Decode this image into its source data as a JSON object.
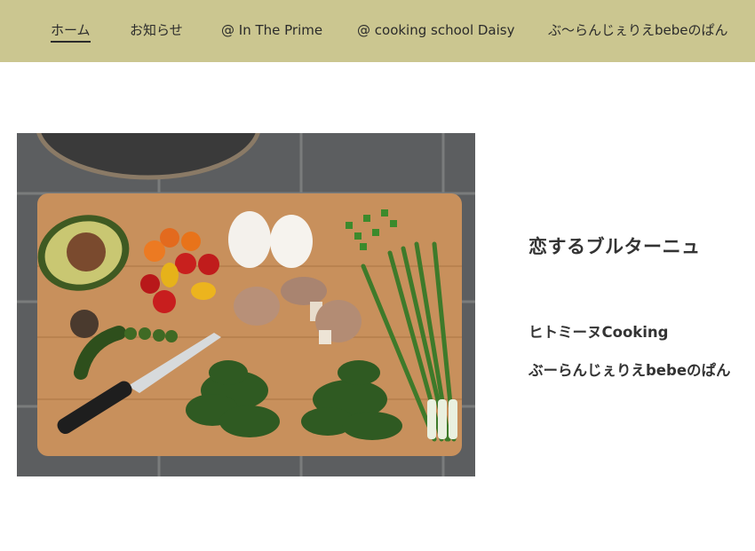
{
  "nav": {
    "items": [
      {
        "label": "ホーム",
        "active": true
      },
      {
        "label": "お知らせ",
        "active": false
      },
      {
        "label": "@ In The Prime",
        "active": false
      },
      {
        "label": "@ cooking school Daisy",
        "active": false
      },
      {
        "label": "ぶ〜らんじぇりえbebeのぱん",
        "active": false
      }
    ]
  },
  "colors": {
    "nav_bg": "#cbc690",
    "text": "#333333"
  },
  "hero_image": {
    "subject": "cutting board with avocado, tomatoes, eggs, mushrooms, spinach, green onions and a knife"
  },
  "side": {
    "title": "恋するブルターニュ",
    "links": [
      {
        "label": "ヒトミーヌCooking"
      },
      {
        "label": "ぶーらんじぇりえbebeのぱん"
      }
    ]
  }
}
